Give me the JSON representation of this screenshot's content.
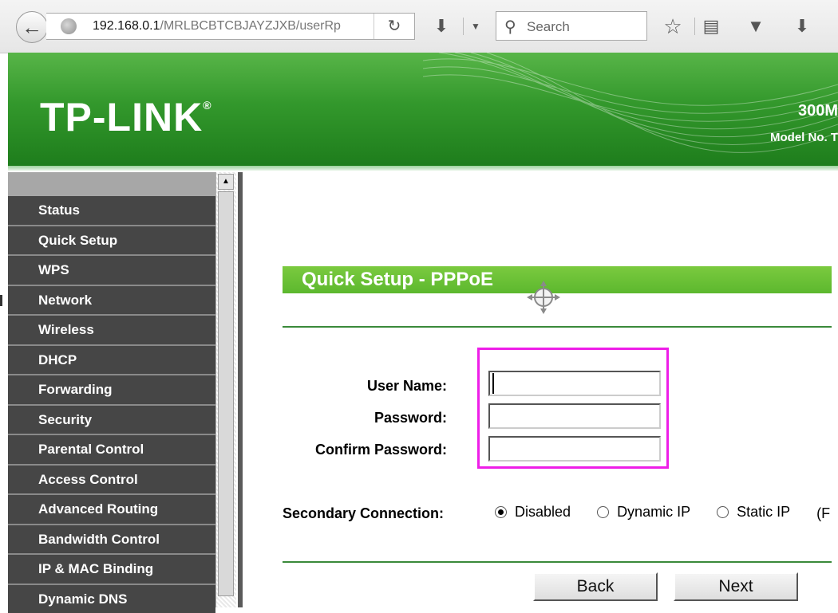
{
  "browser": {
    "url_host": "192.168.0.1",
    "url_path": "/MRLBCBTCBJAYZJXB/userRp",
    "search_placeholder": "Search",
    "reload_glyph": "C",
    "icons": [
      "back-icon",
      "globe-icon",
      "reload-icon",
      "download-arrow-icon",
      "dropdown-icon",
      "search-icon",
      "bookmark-star-icon",
      "reading-list-icon",
      "pocket-icon",
      "downloads-icon"
    ]
  },
  "header": {
    "logo": "TP-LINK",
    "logo_mark": "®",
    "product_partial": "300M",
    "model_partial": "Model No. T"
  },
  "menu": {
    "items": [
      "Status",
      "Quick Setup",
      "WPS",
      "Network",
      "Wireless",
      "DHCP",
      "Forwarding",
      "Security",
      "Parental Control",
      "Access Control",
      "Advanced Routing",
      "Bandwidth Control",
      "IP & MAC Binding",
      "Dynamic DNS"
    ]
  },
  "page": {
    "title": "Quick Setup - PPPoE",
    "labels": {
      "user_name": "User Name:",
      "password": "Password:",
      "confirm_password": "Confirm Password:",
      "secondary_connection": "Secondary Connection:"
    },
    "fields": {
      "user_name": "",
      "password": "",
      "confirm_password": ""
    },
    "secondary_options": [
      {
        "label": "Disabled",
        "selected": true
      },
      {
        "label": "Dynamic IP",
        "selected": false
      },
      {
        "label": "Static IP",
        "selected": false
      },
      {
        "label": "(F",
        "selected": false
      }
    ],
    "buttons": {
      "back": "Back",
      "next": "Next"
    }
  },
  "colors": {
    "brand_green": "#33982c",
    "title_green": "#6cc236",
    "highlight": "#ee1ee8",
    "menu_bg": "#464646"
  }
}
